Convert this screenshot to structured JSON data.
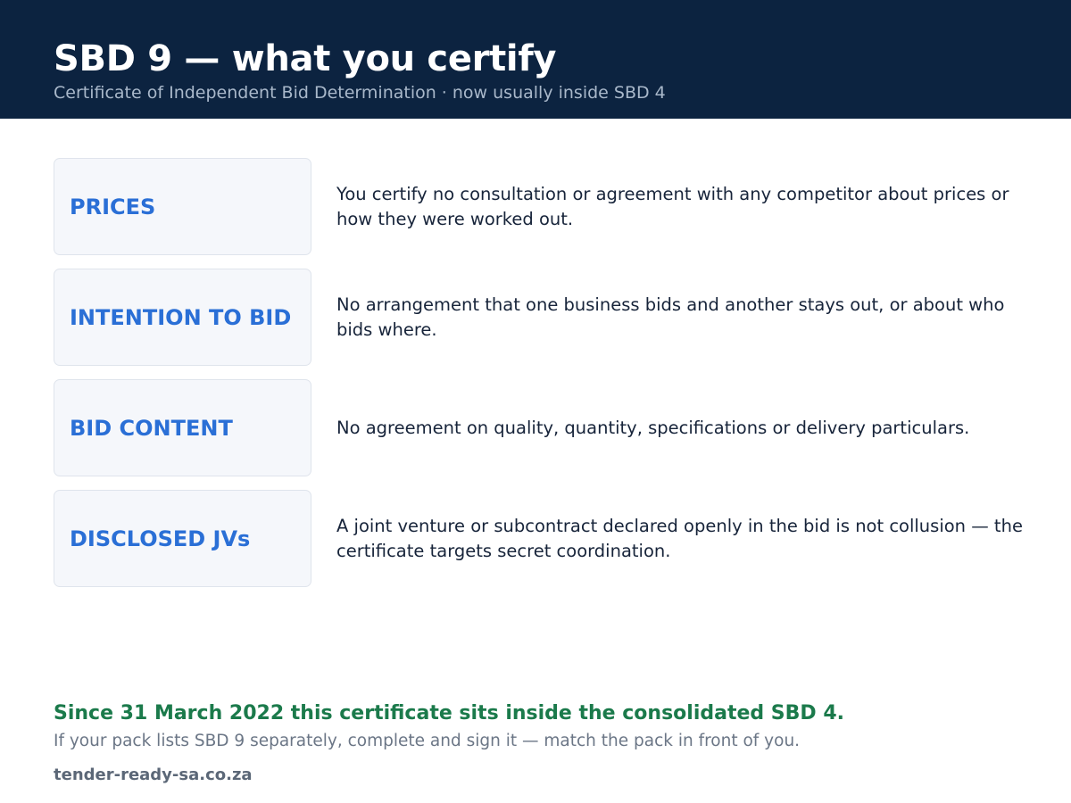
{
  "header": {
    "title": "SBD 9 — what you certify",
    "subtitle": "Certificate of Independent Bid Determination · now usually inside SBD 4"
  },
  "rows": [
    {
      "label": "PRICES",
      "text": "You certify no consultation or agreement with any competitor about prices or how they were worked out."
    },
    {
      "label": "INTENTION TO BID",
      "text": "No arrangement that one business bids and another stays out, or about who bids where."
    },
    {
      "label": "BID CONTENT",
      "text": "No agreement on quality, quantity, specifications or delivery particulars."
    },
    {
      "label": "DISCLOSED JVs",
      "text": "A joint venture or subcontract declared openly in the bid is not collusion — the certificate targets secret coordination."
    }
  ],
  "footer": {
    "highlight": "Since 31 March 2022 this certificate sits inside the consolidated SBD 4.",
    "note": "If your pack lists SBD 9 separately, complete and sign it — match the pack in front of you.",
    "website": "tender-ready-sa.co.za"
  },
  "colors": {
    "header_bg": "#0c2340",
    "label_blue": "#2a6fd6",
    "highlight_green": "#1b7a4b"
  }
}
